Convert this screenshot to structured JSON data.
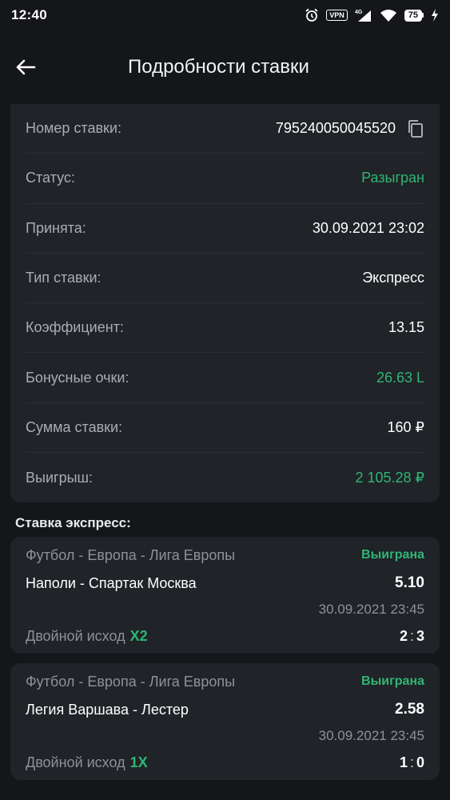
{
  "status_bar": {
    "time": "12:40",
    "vpn": "VPN",
    "network": "4G",
    "battery": "75"
  },
  "header": {
    "title": "Подробности ставки",
    "back_icon": "arrow-left-icon"
  },
  "details": [
    {
      "label": "Номер ставки:",
      "value": "795240050045520",
      "green": false,
      "copy": true
    },
    {
      "label": "Статус:",
      "value": "Разыгран",
      "green": true
    },
    {
      "label": "Принята:",
      "value": "30.09.2021 23:02",
      "green": false
    },
    {
      "label": "Тип ставки:",
      "value": "Экспресс",
      "green": false
    },
    {
      "label": "Коэффициент:",
      "value": "13.15",
      "green": false
    },
    {
      "label": "Бонусные очки:",
      "value": "26.63 L",
      "green": true
    },
    {
      "label": "Сумма ставки:",
      "value": "160 ₽",
      "green": false
    },
    {
      "label": "Выигрыш:",
      "value": "2 105.28 ₽",
      "green": true
    }
  ],
  "express": {
    "title": "Ставка экспресс:",
    "events": [
      {
        "league": "Футбол - Европа - Лига Европы",
        "result": "Выиграна",
        "match": "Наполи - Спартак Москва",
        "odds": "5.10",
        "datetime": "30.09.2021 23:45",
        "market": "Двойной исход",
        "pick": "X2",
        "score_home": "2",
        "score_sep": ":",
        "score_away": "3"
      },
      {
        "league": "Футбол - Европа - Лига Европы",
        "result": "Выиграна",
        "match": "Легия Варшава - Лестер",
        "odds": "2.58",
        "datetime": "30.09.2021 23:45",
        "market": "Двойной исход",
        "pick": "1X",
        "score_home": "1",
        "score_sep": ":",
        "score_away": "0"
      }
    ]
  },
  "colors": {
    "background": "#141619",
    "card": "#202327",
    "accent_green": "#2fb575",
    "muted": "#a9adb3"
  }
}
